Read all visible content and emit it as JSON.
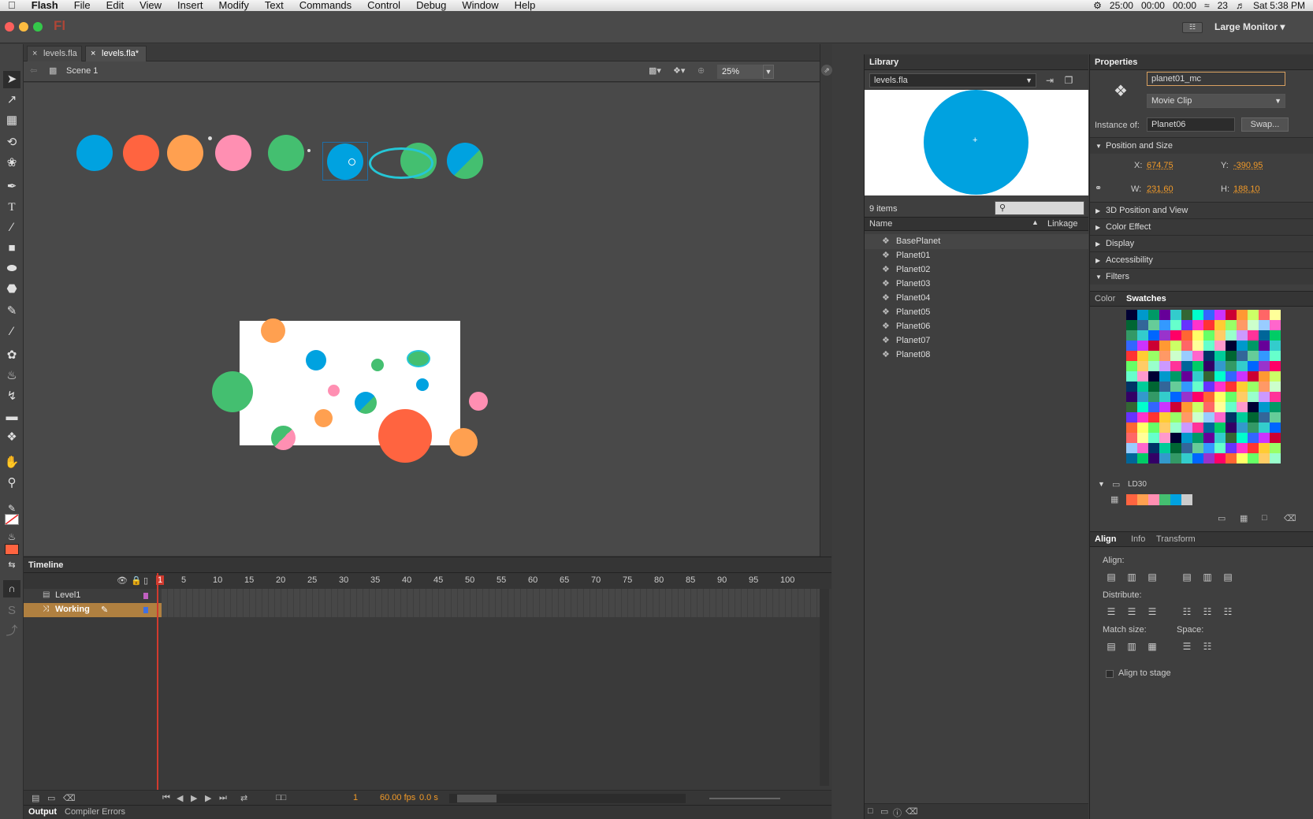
{
  "menubar": {
    "apple": "",
    "items": [
      "Flash",
      "File",
      "Edit",
      "View",
      "Insert",
      "Modify",
      "Text",
      "Commands",
      "Control",
      "Debug",
      "Window",
      "Help"
    ],
    "status": [
      "25:00",
      "00:00",
      "00:00",
      "23",
      "Sat 5:38 PM"
    ]
  },
  "titlebar": {
    "logo": "Fl",
    "workspace": "Large Monitor"
  },
  "doc_tabs": [
    "levels.fla",
    "levels.fla*"
  ],
  "editbar": {
    "scene": "Scene 1",
    "zoom": "25%"
  },
  "timeline": {
    "title": "Timeline",
    "ruler": [
      "1",
      "5",
      "10",
      "15",
      "20",
      "25",
      "30",
      "35",
      "40",
      "45",
      "50",
      "55",
      "60",
      "65",
      "70",
      "75",
      "80",
      "85",
      "90",
      "95",
      "100"
    ],
    "layers": [
      "Level1",
      "Working"
    ],
    "status": {
      "frame": "1",
      "fps": "60.00 fps",
      "time": "0.0 s"
    }
  },
  "output_tabs": [
    "Output",
    "Compiler Errors"
  ],
  "library": {
    "title": "Library",
    "file": "levels.fla",
    "count": "9 items",
    "col_name": "Name",
    "col_linkage": "Linkage",
    "items": [
      "BasePlanet",
      "Planet01",
      "Planet02",
      "Planet03",
      "Planet04",
      "Planet05",
      "Planet06",
      "Planet07",
      "Planet08"
    ]
  },
  "properties": {
    "title": "Properties",
    "instance_name": "planet01_mc",
    "type": "Movie Clip",
    "instance_of_label": "Instance of:",
    "instance_of": "Planet06",
    "swap": "Swap...",
    "sections": [
      "Position and Size",
      "3D Position and View",
      "Color Effect",
      "Display",
      "Accessibility",
      "Filters"
    ],
    "x_label": "X:",
    "x": "674.75",
    "y_label": "Y:",
    "y": "-390.95",
    "w_label": "W:",
    "w": "231.60",
    "h_label": "H:",
    "h": "188.10"
  },
  "color_panel": {
    "tabs": [
      "Color",
      "Swatches"
    ],
    "folder": "LD30"
  },
  "align_panel": {
    "tabs": [
      "Align",
      "Info",
      "Transform"
    ],
    "align": "Align:",
    "distribute": "Distribute:",
    "match_size": "Match size:",
    "space": "Space:",
    "align_to_stage": "Align to stage"
  },
  "colors": {
    "blue": "#00a2e0",
    "orange_red": "#ff6440",
    "orange": "#ffa050",
    "pink": "#ff8fb2",
    "green": "#44bf70"
  }
}
